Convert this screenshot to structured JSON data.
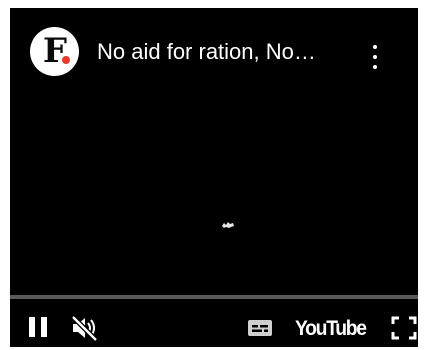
{
  "player": {
    "channel": {
      "avatar_letter": "F",
      "avatar_dot_color": "#e8382f"
    },
    "title": "No aid for ration, No…",
    "overflow_icon": "more-vertical-icon",
    "progress": {
      "played_fraction": 0.0,
      "track_color": "#5a5a5a",
      "played_color": "#ff0000"
    },
    "controls": {
      "play_state_icon": "pause-icon",
      "volume_icon": "muted-speaker-icon",
      "subtitles_icon": "subtitles-icon",
      "brand_label": "YouTube",
      "fullscreen_icon": "fullscreen-icon"
    }
  }
}
